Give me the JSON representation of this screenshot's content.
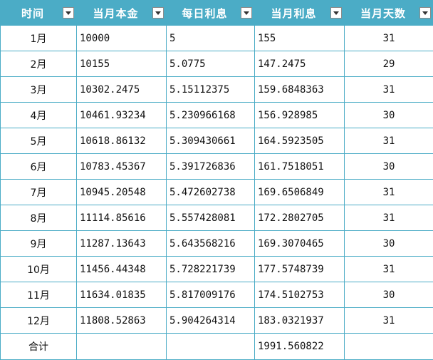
{
  "table": {
    "headers": [
      "时间",
      "当月本金",
      "每日利息",
      "当月利息",
      "当月天数"
    ],
    "rows": [
      {
        "month": "1月",
        "principal": "10000",
        "daily": "5",
        "monthly": "155",
        "days": "31"
      },
      {
        "month": "2月",
        "principal": "10155",
        "daily": "5.0775",
        "monthly": "147.2475",
        "days": "29"
      },
      {
        "month": "3月",
        "principal": "10302.2475",
        "daily": "5.15112375",
        "monthly": "159.6848363",
        "days": "31"
      },
      {
        "month": "4月",
        "principal": "10461.93234",
        "daily": "5.230966168",
        "monthly": "156.928985",
        "days": "30"
      },
      {
        "month": "5月",
        "principal": "10618.86132",
        "daily": "5.309430661",
        "monthly": "164.5923505",
        "days": "31"
      },
      {
        "month": "6月",
        "principal": "10783.45367",
        "daily": "5.391726836",
        "monthly": "161.7518051",
        "days": "30"
      },
      {
        "month": "7月",
        "principal": "10945.20548",
        "daily": "5.472602738",
        "monthly": "169.6506849",
        "days": "31"
      },
      {
        "month": "8月",
        "principal": "11114.85616",
        "daily": "5.557428081",
        "monthly": "172.2802705",
        "days": "31"
      },
      {
        "month": "9月",
        "principal": "11287.13643",
        "daily": "5.643568216",
        "monthly": "169.3070465",
        "days": "30"
      },
      {
        "month": "10月",
        "principal": "11456.44348",
        "daily": "5.728221739",
        "monthly": "177.5748739",
        "days": "31"
      },
      {
        "month": "11月",
        "principal": "11634.01835",
        "daily": "5.817009176",
        "monthly": "174.5102753",
        "days": "30"
      },
      {
        "month": "12月",
        "principal": "11808.52863",
        "daily": "5.904264314",
        "monthly": "183.0321937",
        "days": "31"
      }
    ],
    "total": {
      "label": "合计",
      "principal": "",
      "daily": "",
      "monthly": "1991.560822",
      "days": ""
    }
  },
  "colors": {
    "header_bg": "#4bacc6",
    "header_text": "#ffffff",
    "grid_line": "#4bacc6"
  },
  "icons": {
    "filter": "chevron-down-icon"
  }
}
